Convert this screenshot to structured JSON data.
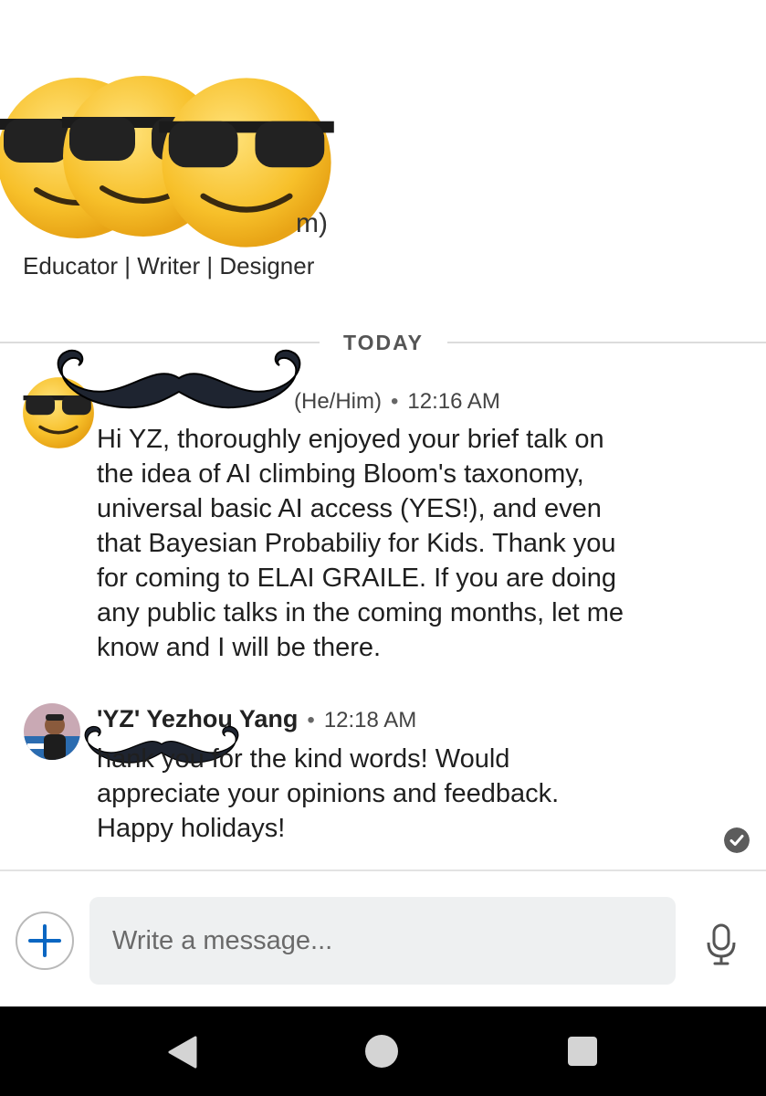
{
  "profile": {
    "name_visible": "m)",
    "headline": "Educator | Writer | Designer"
  },
  "divider": {
    "label": "TODAY"
  },
  "messages": [
    {
      "sender_visible": "(He/Him)",
      "time": "12:16 AM",
      "text": "Hi YZ, thoroughly enjoyed your brief talk on\nthe idea of AI climbing Bloom's taxonomy,\nuniversal basic AI access (YES!), and even\nthat Bayesian Probabiliy for Kids. Thank you\nfor coming to ELAI GRAILE.  If you are doing\nany public talks in the coming months, let me\nknow and I will be there."
    },
    {
      "sender": "'YZ' Yezhou Yang",
      "time": "12:18 AM",
      "text": "            hank you for the kind words! Would\nappreciate your opinions and feedback.\nHappy holidays!"
    }
  ],
  "compose": {
    "placeholder": "Write a message..."
  },
  "icons": {
    "add": "plus-icon",
    "mic": "microphone-icon",
    "read": "checkmark-icon",
    "nav": [
      "back-triangle-icon",
      "home-circle-icon",
      "recents-square-icon"
    ]
  },
  "colors": {
    "accent": "#0a66c2",
    "nav_bar": "#000000",
    "input_bg": "#eef0f1"
  }
}
